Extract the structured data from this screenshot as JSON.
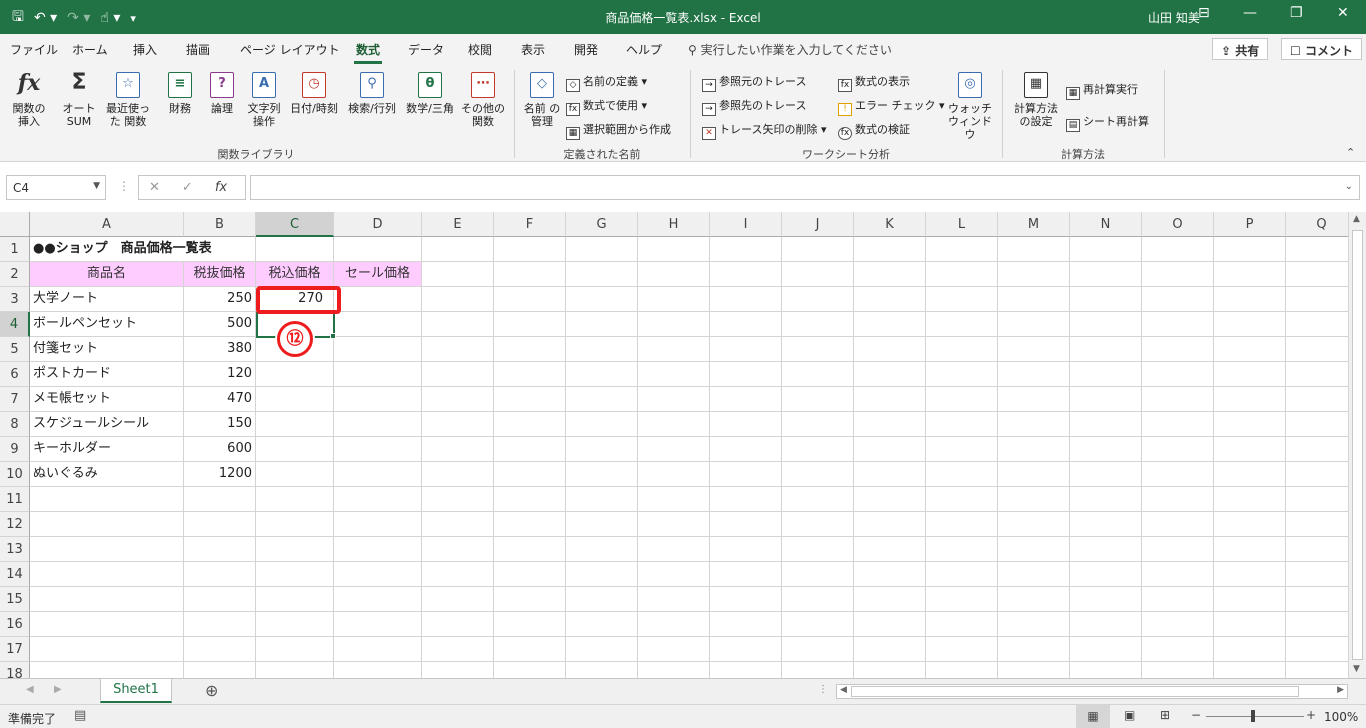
{
  "window": {
    "title": "商品価格一覧表.xlsx  -  Excel",
    "user": "山田 知美"
  },
  "qat": {
    "save_icon": "save-icon",
    "undo_icon": "undo-icon",
    "redo_icon": "redo-icon",
    "touch_icon": "touch-mode-icon"
  },
  "tabs": [
    "ファイル",
    "ホーム",
    "挿入",
    "描画",
    "ページ レイアウト",
    "数式",
    "データ",
    "校閲",
    "表示",
    "開発",
    "ヘルプ"
  ],
  "active_tab": "数式",
  "tell_me": "実行したい作業を入力してください",
  "share_label": "共有",
  "comment_label": "コメント",
  "ribbon": {
    "library": {
      "insert_function": "関数の挿入",
      "autosum": "オート SUM",
      "recent": "最近使った 関数",
      "financial": "財務",
      "logical": "論理",
      "text": "文字列 操作",
      "datetime": "日付/時刻",
      "lookup": "検索/行列",
      "math": "数学/三角",
      "more": "その他の 関数",
      "group_label": "関数ライブラリ"
    },
    "names": {
      "name_manager": "名前 の管理",
      "define_name": "名前の定義",
      "use_in_formula": "数式で使用",
      "create_from_selection": "選択範囲から作成",
      "group_label": "定義された名前"
    },
    "audit": {
      "trace_precedents": "参照元のトレース",
      "trace_dependents": "参照先のトレース",
      "remove_arrows": "トレース矢印の削除",
      "show_formulas": "数式の表示",
      "error_check": "エラー チェック",
      "evaluate": "数式の検証",
      "watch_window": "ウォッチ ウィンドウ",
      "group_label": "ワークシート分析"
    },
    "calc": {
      "options": "計算方法 の設定",
      "calc_now": "再計算実行",
      "calc_sheet": "シート再計算",
      "group_label": "計算方法"
    }
  },
  "name_box": "C4",
  "formula": "",
  "columns": [
    "A",
    "B",
    "C",
    "D",
    "E",
    "F",
    "G",
    "H",
    "I",
    "J",
    "K",
    "L",
    "M",
    "N",
    "O",
    "P",
    "Q"
  ],
  "rows": [
    "1",
    "2",
    "3",
    "4",
    "5",
    "6",
    "7",
    "8",
    "9",
    "10",
    "11",
    "12",
    "13",
    "14",
    "15",
    "16",
    "17",
    "18"
  ],
  "sheet_title": "●●ショップ　商品価格一覧表",
  "headers": [
    "商品名",
    "税抜価格",
    "税込価格",
    "セール価格"
  ],
  "products": [
    {
      "name": "大学ノート",
      "price": "250",
      "tax": "270"
    },
    {
      "name": "ボールペンセット",
      "price": "500"
    },
    {
      "name": "付箋セット",
      "price": "380"
    },
    {
      "name": "ポストカード",
      "price": "120"
    },
    {
      "name": "メモ帳セット",
      "price": "470"
    },
    {
      "name": "スケジュールシール",
      "price": "150"
    },
    {
      "name": "キーホルダー",
      "price": "600"
    },
    {
      "name": "ぬいぐるみ",
      "price": "1200"
    }
  ],
  "annotation": "⑫",
  "sheet_tab": "Sheet1",
  "status": "準備完了",
  "zoom": "100%"
}
